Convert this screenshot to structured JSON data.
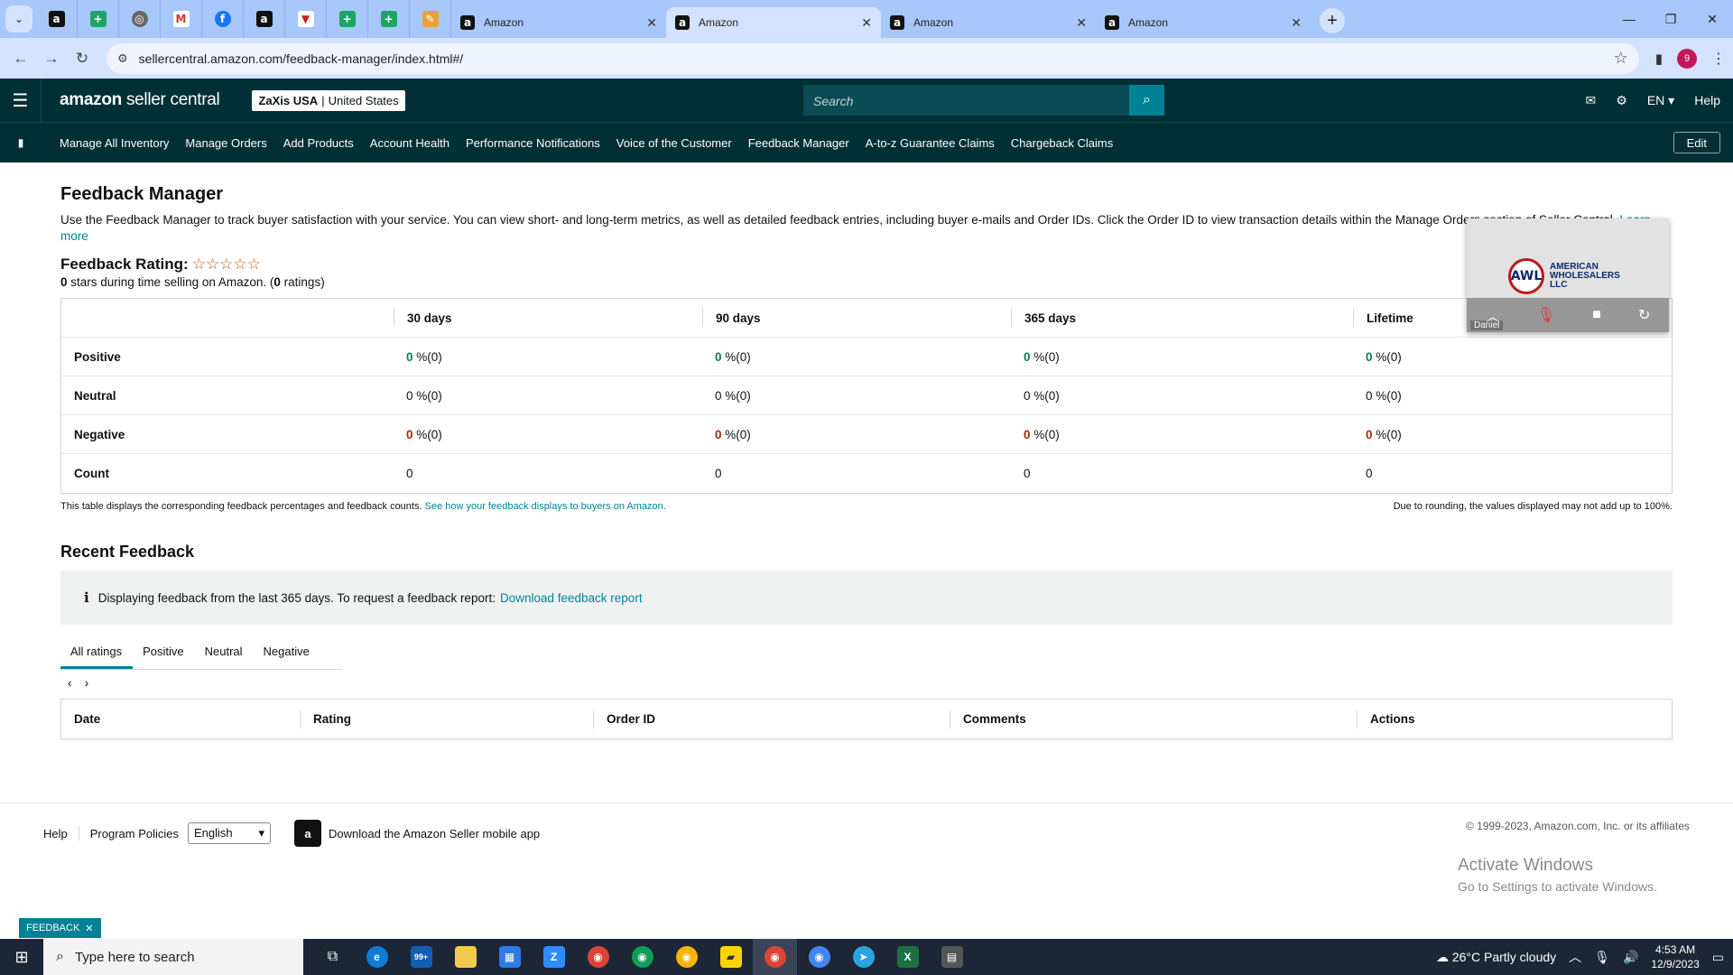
{
  "browser": {
    "tabs": [
      {
        "title": "Amazon",
        "active": false
      },
      {
        "title": "Amazon",
        "active": true
      },
      {
        "title": "Amazon",
        "active": false
      },
      {
        "title": "Amazon",
        "active": false
      }
    ],
    "url": "sellercentral.amazon.com/feedback-manager/index.html#/",
    "profile_initial": "9"
  },
  "header": {
    "logo_brand": "amazon",
    "logo_product": "seller central",
    "store_name": "ZaXis USA",
    "store_region": "United States",
    "search_placeholder": "Search",
    "language": "EN",
    "help": "Help"
  },
  "nav": {
    "links": [
      "Manage All Inventory",
      "Manage Orders",
      "Add Products",
      "Account Health",
      "Performance Notifications",
      "Voice of the Customer",
      "Feedback Manager",
      "A-to-z Guarantee Claims",
      "Chargeback Claims"
    ],
    "edit": "Edit"
  },
  "page": {
    "title": "Feedback Manager",
    "intro": "Use the Feedback Manager to track buyer satisfaction with your service. You can view short- and long-term metrics, as well as detailed feedback entries, including buyer e-mails and Order IDs. Click the Order ID to view transaction details within the Manage Orders section of Seller Central.",
    "learn_more": "Learn more",
    "rating_label": "Feedback Rating:",
    "stars": "☆☆☆☆☆",
    "stars_count": "0",
    "stars_mid": "stars during time selling on Amazon. (",
    "ratings_count": "0",
    "ratings_suffix": "ratings)"
  },
  "metrics": {
    "headers": [
      "",
      "30 days",
      "90 days",
      "365 days",
      "Lifetime"
    ],
    "rows": [
      {
        "label": "Positive",
        "values": [
          "0",
          "0",
          "0",
          "0"
        ],
        "suffix": "%(0)"
      },
      {
        "label": "Neutral",
        "values": [
          "0",
          "0",
          "0",
          "0"
        ],
        "suffix": "%(0)"
      },
      {
        "label": "Negative",
        "values": [
          "0",
          "0",
          "0",
          "0"
        ],
        "suffix": "%(0)"
      },
      {
        "label": "Count",
        "values": [
          "0",
          "0",
          "0",
          "0"
        ],
        "suffix": ""
      }
    ],
    "footnote": "This table displays the corresponding feedback percentages and feedback counts.",
    "footnote_link": "See how your feedback displays to buyers on Amazon.",
    "rounding_note": "Due to rounding, the values displayed may not add up to 100%."
  },
  "recent": {
    "title": "Recent Feedback",
    "info_text": "Displaying feedback from the last 365 days. To request a feedback report:",
    "info_link": "Download feedback report",
    "tabs": [
      "All ratings",
      "Positive",
      "Neutral",
      "Negative"
    ],
    "columns": [
      "Date",
      "Rating",
      "Order ID",
      "Comments",
      "Actions"
    ]
  },
  "footer": {
    "help": "Help",
    "policies": "Program Policies",
    "language": "English",
    "app": "Download the Amazon Seller mobile app",
    "copyright": "© 1999-2023, Amazon.com, Inc. or its affiliates",
    "activate_title": "Activate Windows",
    "activate_sub": "Go to Settings to activate Windows.",
    "feedback_pill": "FEEDBACK"
  },
  "video": {
    "company_line1": "AMERICAN",
    "company_line2": "WHOLESALERS",
    "company_line3": "LLC",
    "mark": "AWL",
    "participant": "Daniel"
  },
  "taskbar": {
    "search_placeholder": "Type here to search",
    "weather": "26°C  Partly cloudy",
    "time": "4:53 AM",
    "date": "12/9/2023",
    "mail_badge": "99+"
  }
}
